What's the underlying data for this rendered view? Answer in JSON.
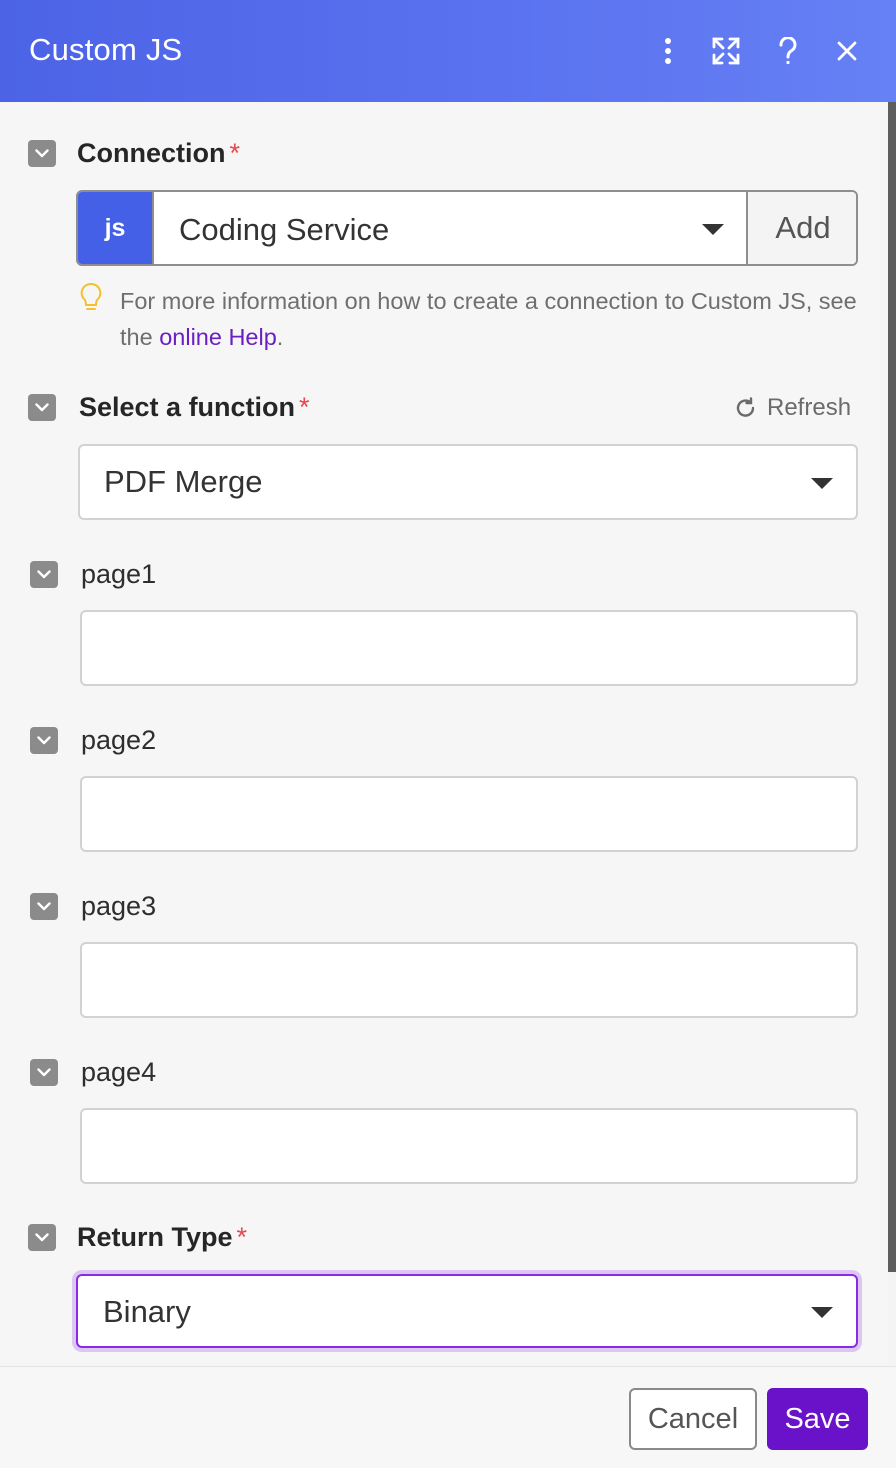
{
  "window": {
    "title": "Custom JS",
    "header_icons": [
      "more-vertical-icon",
      "expand-icon",
      "help-icon",
      "close-icon"
    ]
  },
  "connection": {
    "label": "Connection",
    "required_mark": "*",
    "badge": "js",
    "selected": "Coding Service",
    "add_label": "Add",
    "hint_prefix": "For more information on how to create a connection to Custom JS, see the ",
    "hint_link": "online Help",
    "hint_suffix": "."
  },
  "function": {
    "label": "Select a function",
    "required_mark": "*",
    "refresh_label": "Refresh",
    "selected": "PDF Merge"
  },
  "fields": [
    {
      "label": "page1",
      "value": ""
    },
    {
      "label": "page2",
      "value": ""
    },
    {
      "label": "page3",
      "value": ""
    },
    {
      "label": "page4",
      "value": ""
    }
  ],
  "return_type": {
    "label": "Return Type",
    "required_mark": "*",
    "selected": "Binary"
  },
  "footer": {
    "cancel_label": "Cancel",
    "save_label": "Save"
  },
  "colors": {
    "header": "#5a72ef",
    "js_badge": "#4460e6",
    "save_button": "#6a12c9",
    "link": "#6a1fc2",
    "required": "#e5484d",
    "focus_ring": "#8a2be2"
  }
}
